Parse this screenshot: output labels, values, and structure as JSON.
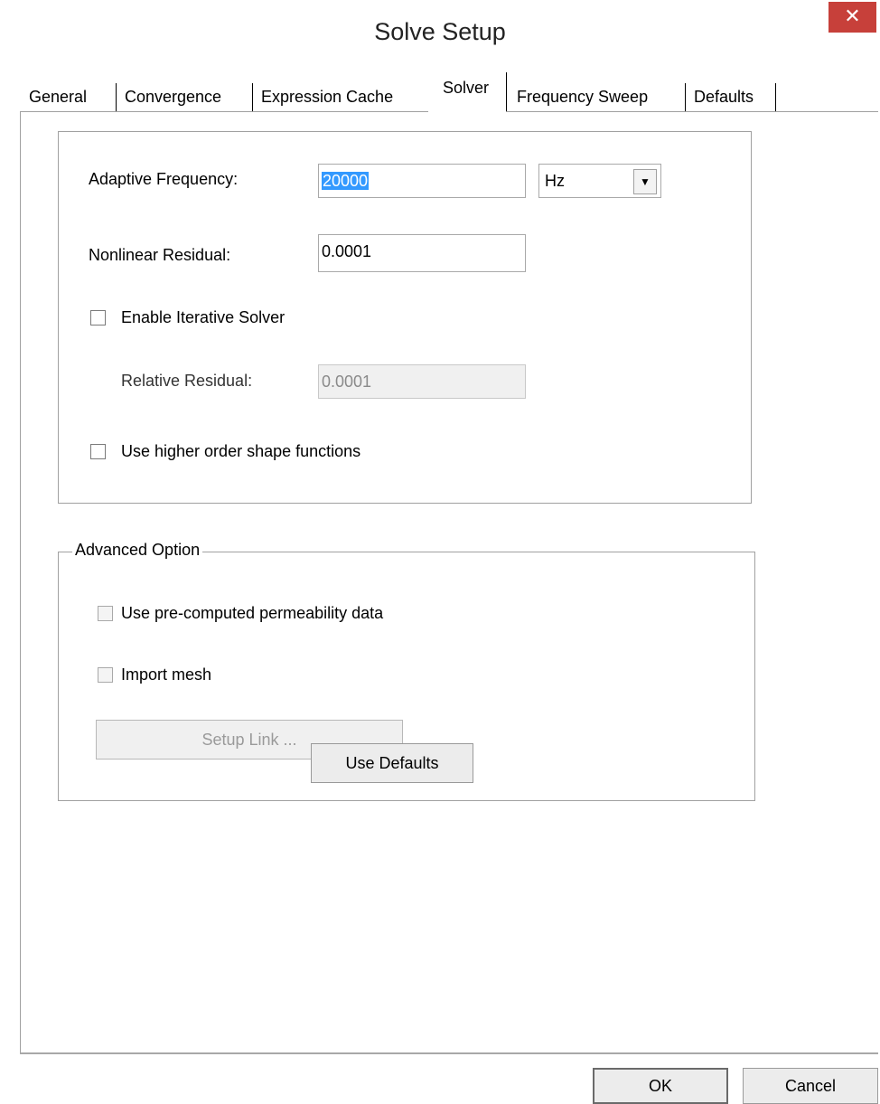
{
  "window": {
    "title": "Solve Setup",
    "close_glyph": "✕",
    "accent_close": "#c7403a"
  },
  "tabs": [
    {
      "label": "General"
    },
    {
      "label": "Convergence"
    },
    {
      "label": "Expression Cache"
    },
    {
      "label": "Solver",
      "active": true
    },
    {
      "label": "Frequency Sweep"
    },
    {
      "label": "Defaults"
    }
  ],
  "solver": {
    "adaptive_frequency_label": "Adaptive Frequency:",
    "adaptive_frequency_value": "20000",
    "frequency_unit": "Hz",
    "nonlinear_residual_label": "Nonlinear Residual:",
    "nonlinear_residual_value": "0.0001",
    "enable_iterative_label": "Enable Iterative Solver",
    "enable_iterative_checked": false,
    "relative_residual_label": "Relative Residual:",
    "relative_residual_value": "0.0001",
    "higher_order_label": "Use higher order shape functions",
    "higher_order_checked": false
  },
  "advanced": {
    "legend": "Advanced Option",
    "precomputed_label": "Use pre-computed permeability data",
    "precomputed_checked": false,
    "import_mesh_label": "Import mesh",
    "import_mesh_checked": false,
    "setup_link_label": "Setup Link ..."
  },
  "buttons": {
    "use_defaults": "Use Defaults",
    "ok": "OK",
    "cancel": "Cancel"
  }
}
